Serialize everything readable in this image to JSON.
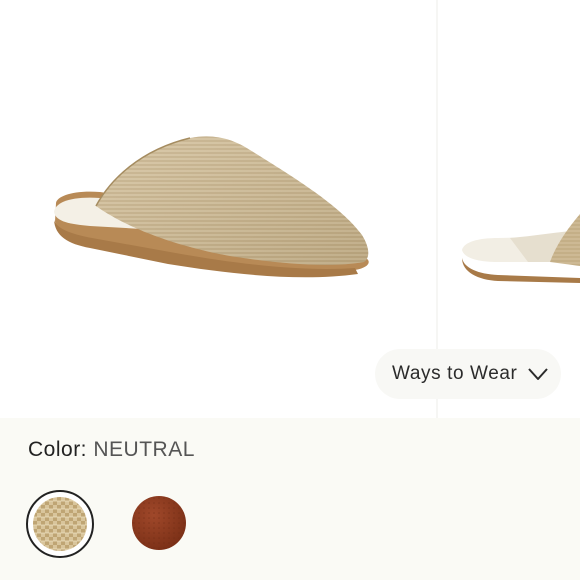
{
  "gallery": {
    "main_image_alt": "Beige woven pointed-toe mule",
    "next_image_alt": "Beige woven mule, side view"
  },
  "ways_to_wear": {
    "label": "Ways to Wear",
    "icon": "chevron-down-icon"
  },
  "color": {
    "label": "Color:",
    "value": "NEUTRAL",
    "swatches": [
      {
        "name": "Neutral",
        "selected": true,
        "color": "#c9b48a"
      },
      {
        "name": "Brown",
        "selected": false,
        "color": "#8a3a1e"
      }
    ]
  },
  "colors": {
    "accent_text": "#222222",
    "options_bg": "#fafaf5"
  }
}
